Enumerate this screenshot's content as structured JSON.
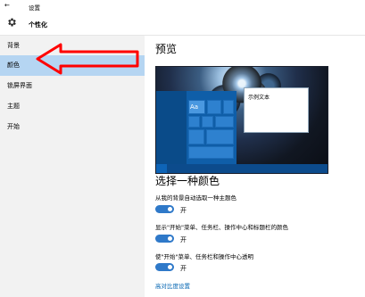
{
  "titlebar": {
    "title": "设置"
  },
  "header": {
    "name": "个性化"
  },
  "sidebar": {
    "items": [
      {
        "label": "背景"
      },
      {
        "label": "颜色"
      },
      {
        "label": "锁屏界面"
      },
      {
        "label": "主题"
      },
      {
        "label": "开始"
      }
    ]
  },
  "content": {
    "preview_title": "预览",
    "sample_text": "示例文本",
    "sample_tile": "Aa",
    "color_title": "选择一种颜色",
    "options": [
      {
        "label": "从我的背景自动选取一种主题色",
        "state": "开"
      },
      {
        "label": "显示\"开始\"菜单、任务栏、操作中心和标题栏的颜色",
        "state": "开"
      },
      {
        "label": "使\"开始\"菜单、任务栏和操作中心透明",
        "state": "开"
      }
    ],
    "link": "高对比度设置"
  },
  "colors": {
    "accent": "#2f79c9",
    "selection": "#b5d5f2",
    "sidebar": "#f2f2f2",
    "annotation": "#ff0000"
  }
}
